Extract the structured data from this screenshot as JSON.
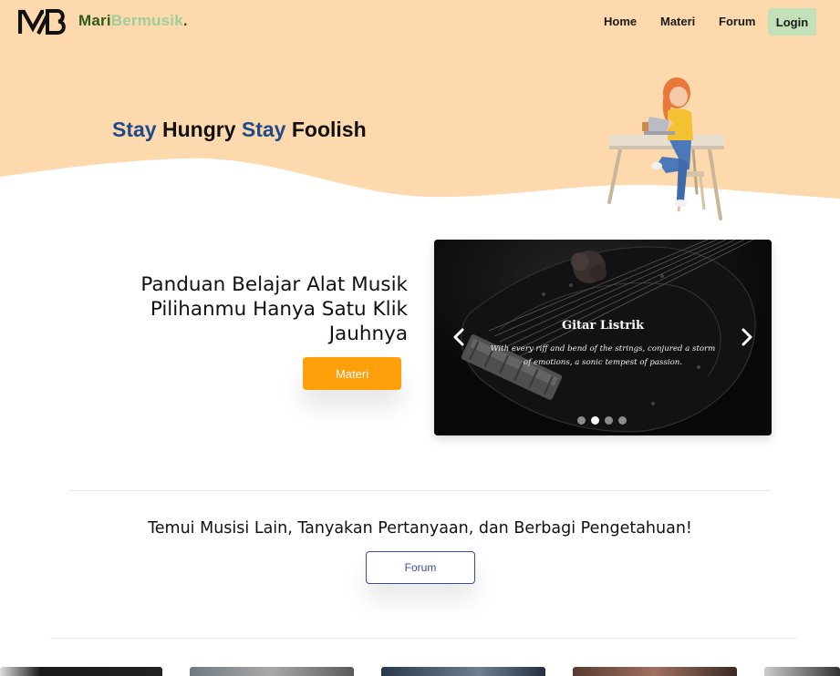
{
  "brand": {
    "logo_icon": "mb-monogram-logo",
    "name_part1": "Mari",
    "name_part2": "Bermusik",
    "name_part3": ".",
    "colors": {
      "dark_green": "#2f5a1e",
      "light_green": "#9ccf9a"
    }
  },
  "nav": {
    "home": "Home",
    "materi": "Materi",
    "forum": "Forum",
    "login": "Login"
  },
  "hero": {
    "tagline": [
      "Stay",
      "Hungry",
      "Stay",
      "Foolish"
    ],
    "background_color": "#fdd9ad",
    "illustration_icon": "girl-laptop-desk-illustration"
  },
  "guide": {
    "title_lines": [
      "Panduan Belajar Alat Musik",
      "Pilihanmu Hanya Satu Klik",
      "Jauhnya"
    ],
    "button": "Materi",
    "button_color": "#ff9f0a"
  },
  "carousel": {
    "slide_title": "Gitar Listrik",
    "slide_caption_lines": [
      "With every riff and bend of the strings, conjured a storm",
      "of emotions, a sonic tempest of passion."
    ],
    "prev_icon": "chevron-left-icon",
    "next_icon": "chevron-right-icon",
    "slide_count": 4,
    "active_index": 1
  },
  "forum_section": {
    "text": "Temui Musisi Lain, Tanyakan Pertanyaan, dan Berbagi Pengetahuan!",
    "button": "Forum",
    "button_color": "#3a4a9a"
  }
}
